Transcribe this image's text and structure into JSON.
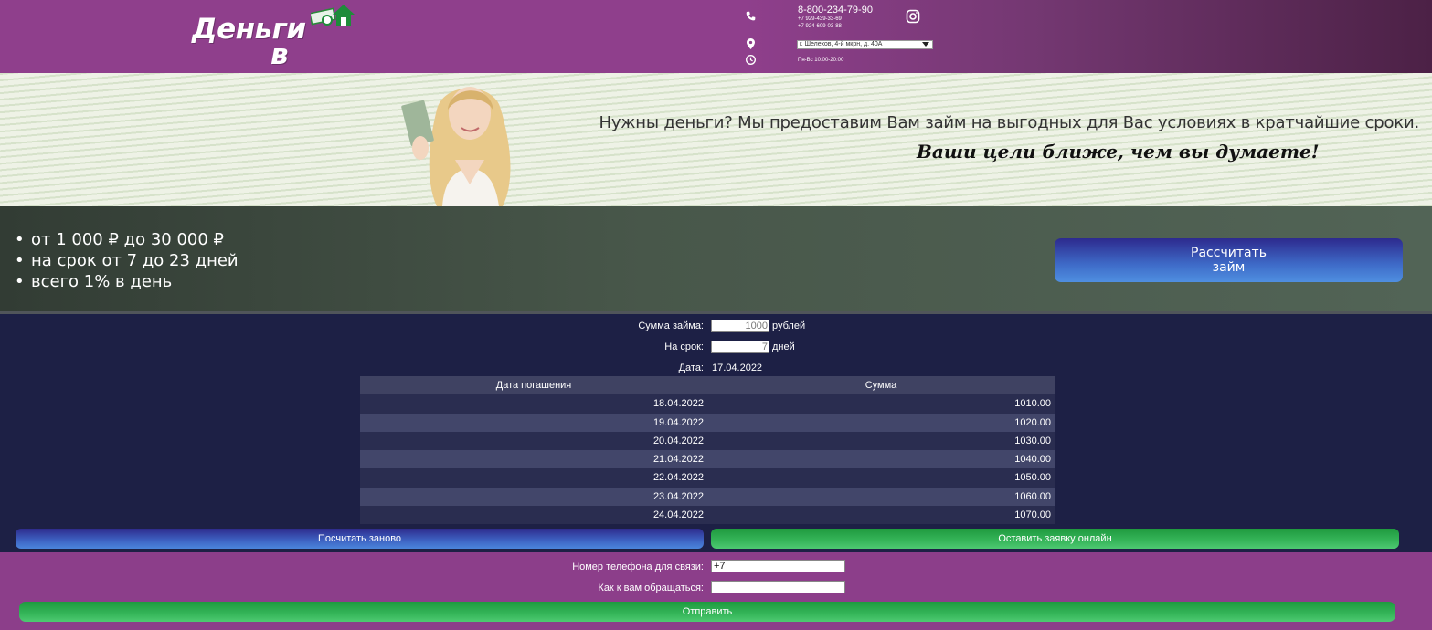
{
  "brand": {
    "logo_line1": "Деньги",
    "logo_line2": "в Дом"
  },
  "contacts": {
    "phone_main": "8-800-234-79-90",
    "phone_2": "+7 929-439-33-69",
    "phone_3": "+7 924-609-03-88",
    "address_selected": "г. Шелехов, 4-й мкрн, д. 40А",
    "hours": "Пн-Вс 10:00-20:00",
    "phone_icon": "phone-icon",
    "location_icon": "map-marker-icon",
    "clock_icon": "clock-icon",
    "social_icon": "instagram-icon"
  },
  "banner": {
    "headline": "Нужны деньги? Мы предоставим Вам займ на выгодных для Вас условиях в кратчайшие сроки.",
    "slogan": "Ваши цели ближе, чем вы думаете!"
  },
  "features": {
    "items": [
      "от 1 000 ₽ до 30 000 ₽",
      "на срок от 7 до 23 дней",
      "всего 1% в день"
    ],
    "calc_button_line1": "Рассчитать",
    "calc_button_line2": "займ"
  },
  "calculator": {
    "amount_label": "Сумма займа:",
    "amount_value": "1000",
    "amount_unit": "рублей",
    "term_label": "На срок:",
    "term_value": "7",
    "term_unit": "дней",
    "date_label": "Дата:",
    "date_value": "17.04.2022",
    "table_headers": [
      "Дата погашения",
      "Сумма"
    ],
    "schedule": [
      {
        "date": "18.04.2022",
        "sum": "1010.00"
      },
      {
        "date": "19.04.2022",
        "sum": "1020.00"
      },
      {
        "date": "20.04.2022",
        "sum": "1030.00"
      },
      {
        "date": "21.04.2022",
        "sum": "1040.00"
      },
      {
        "date": "22.04.2022",
        "sum": "1050.00"
      },
      {
        "date": "23.04.2022",
        "sum": "1060.00"
      },
      {
        "date": "24.04.2022",
        "sum": "1070.00"
      }
    ],
    "recalc_button": "Посчитать заново",
    "apply_button": "Оставить заявку онлайн"
  },
  "form": {
    "phone_label": "Номер телефона для связи:",
    "phone_value": "+7",
    "name_label": "Как к вам обращаться:",
    "name_value": "",
    "submit_button": "Отправить"
  },
  "colors": {
    "header_purple": "#8f3f8c",
    "calc_background": "#1d2045",
    "blue_button": "#3e64c4",
    "green_button": "#36b55a"
  }
}
